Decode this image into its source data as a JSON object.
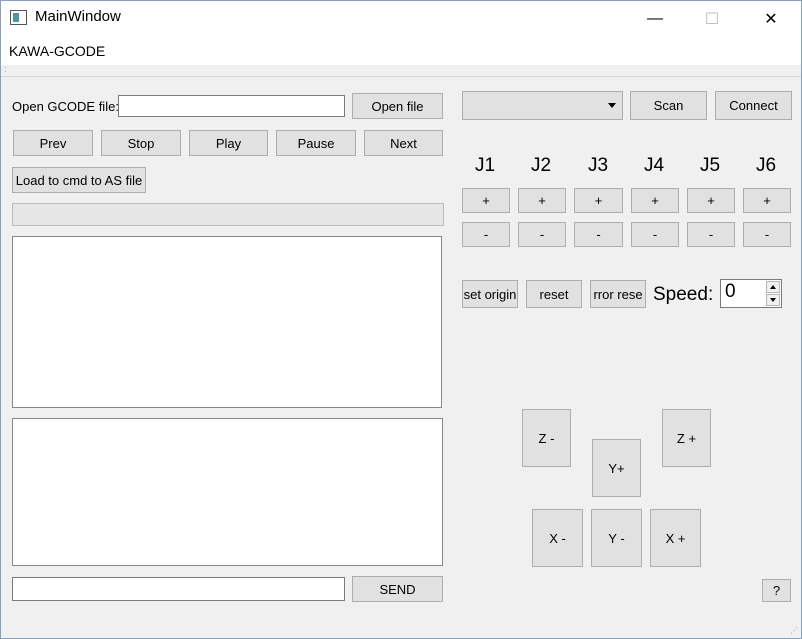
{
  "window": {
    "title": "MainWindow",
    "minimize_glyph": "—",
    "maximize_glyph": "☐",
    "close_glyph": "✕"
  },
  "menu": {
    "items": [
      "KAWA-GCODE"
    ]
  },
  "file": {
    "label": "Open GCODE file:",
    "value": "",
    "open_button": "Open file"
  },
  "playback": {
    "prev": "Prev",
    "stop": "Stop",
    "play": "Play",
    "pause": "Pause",
    "next": "Next"
  },
  "load_button": "Load to cmd to AS file",
  "progress": {
    "value_percent": 0
  },
  "command": {
    "input_value": "",
    "send_button": "SEND"
  },
  "connection": {
    "port_selected": "",
    "scan_button": "Scan",
    "connect_button": "Connect"
  },
  "joints": [
    {
      "label": "J1",
      "plus": "+",
      "minus": "-"
    },
    {
      "label": "J2",
      "plus": "+",
      "minus": "-"
    },
    {
      "label": "J3",
      "plus": "+",
      "minus": "-"
    },
    {
      "label": "J4",
      "plus": "+",
      "minus": "-"
    },
    {
      "label": "J5",
      "plus": "+",
      "minus": "-"
    },
    {
      "label": "J6",
      "plus": "+",
      "minus": "-"
    }
  ],
  "controls": {
    "set_origin": "set origin",
    "reset": "reset",
    "error_reset": "rror rese",
    "speed_label": "Speed:",
    "speed_value": "0"
  },
  "jog": {
    "z_minus": "Z -",
    "z_plus": "Z +",
    "y_plus": "Y+",
    "x_minus": "X -",
    "y_minus": "Y -",
    "x_plus": "X +"
  },
  "help_button": "?"
}
